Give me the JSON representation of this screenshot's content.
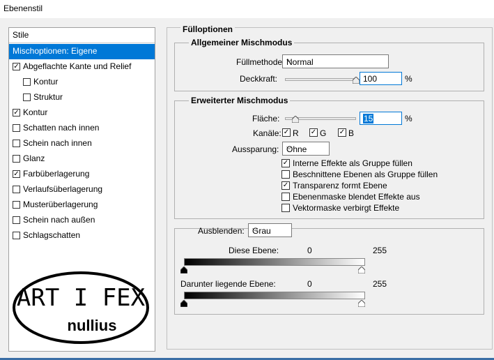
{
  "window": {
    "title": "Ebenenstil"
  },
  "styles_panel": {
    "header": "Stile",
    "items": [
      {
        "label": "Mischoptionen: Eigene",
        "checkbox": false,
        "checked": false,
        "selected": true,
        "indent": 0
      },
      {
        "label": "Abgeflachte Kante und Relief",
        "checkbox": true,
        "checked": true,
        "selected": false,
        "indent": 0
      },
      {
        "label": "Kontur",
        "checkbox": true,
        "checked": false,
        "selected": false,
        "indent": 1
      },
      {
        "label": "Struktur",
        "checkbox": true,
        "checked": false,
        "selected": false,
        "indent": 1
      },
      {
        "label": "Kontur",
        "checkbox": true,
        "checked": true,
        "selected": false,
        "indent": 0
      },
      {
        "label": "Schatten nach innen",
        "checkbox": true,
        "checked": false,
        "selected": false,
        "indent": 0
      },
      {
        "label": "Schein nach innen",
        "checkbox": true,
        "checked": false,
        "selected": false,
        "indent": 0
      },
      {
        "label": "Glanz",
        "checkbox": true,
        "checked": false,
        "selected": false,
        "indent": 0
      },
      {
        "label": "Farbüberlagerung",
        "checkbox": true,
        "checked": true,
        "selected": false,
        "indent": 0
      },
      {
        "label": "Verlaufsüberlagerung",
        "checkbox": true,
        "checked": false,
        "selected": false,
        "indent": 0
      },
      {
        "label": "Musterüberlagerung",
        "checkbox": true,
        "checked": false,
        "selected": false,
        "indent": 0
      },
      {
        "label": "Schein nach außen",
        "checkbox": true,
        "checked": false,
        "selected": false,
        "indent": 0
      },
      {
        "label": "Schlagschatten",
        "checkbox": true,
        "checked": false,
        "selected": false,
        "indent": 0
      }
    ]
  },
  "logo": {
    "line1": "ART I FEX",
    "line2": "nullius"
  },
  "fill_options": {
    "title": "Fülloptionen",
    "general": {
      "title": "Allgemeiner Mischmodus",
      "blend_label": "Füllmethode:",
      "blend_value": "Normal",
      "opacity_label": "Deckkraft:",
      "opacity_value": "100",
      "opacity_fraction": 1.0,
      "percent": "%"
    },
    "advanced": {
      "title": "Erweiterter Mischmodus",
      "fill_label": "Fläche:",
      "fill_value": "15",
      "fill_fraction": 0.15,
      "percent": "%",
      "channels_label": "Kanäle:",
      "channels": [
        {
          "label": "R",
          "checked": true
        },
        {
          "label": "G",
          "checked": true
        },
        {
          "label": "B",
          "checked": true
        }
      ],
      "knockout_label": "Aussparung:",
      "knockout_value": "Ohne",
      "options": [
        {
          "label": "Interne Effekte als Gruppe füllen",
          "checked": true
        },
        {
          "label": "Beschnittene Ebenen als Gruppe füllen",
          "checked": false
        },
        {
          "label": "Transparenz formt Ebene",
          "checked": true
        },
        {
          "label": "Ebenenmaske blendet Effekte aus",
          "checked": false
        },
        {
          "label": "Vektormaske verbirgt Effekte",
          "checked": false
        }
      ]
    },
    "blend_if": {
      "label": "Ausblenden:",
      "value": "Grau",
      "this_layer": {
        "label": "Diese Ebene:",
        "min": "0",
        "max": "255"
      },
      "underlying": {
        "label": "Darunter liegende Ebene:",
        "min": "0",
        "max": "255"
      }
    }
  },
  "colors": {
    "accent": "#0078d7",
    "panel_bg": "#f0f0f0"
  }
}
